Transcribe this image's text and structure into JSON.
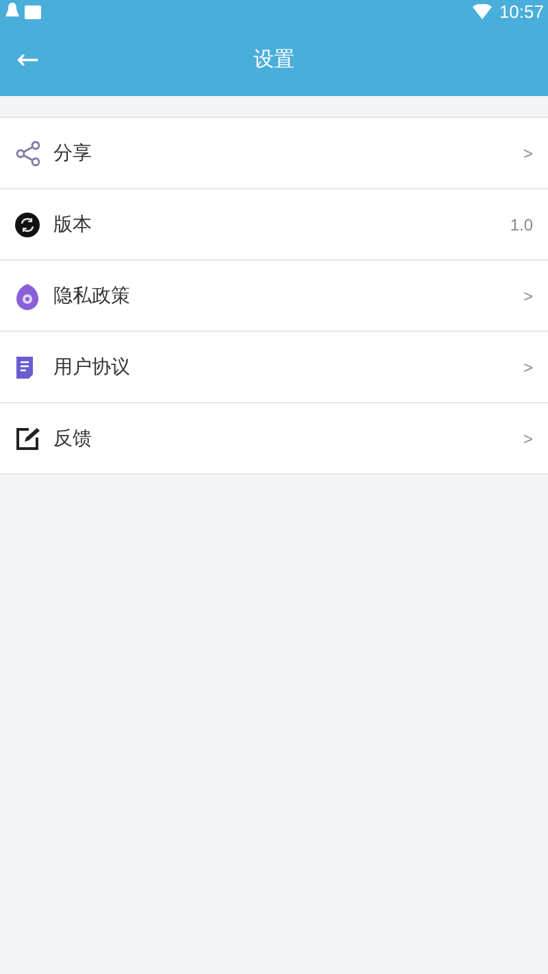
{
  "status_bar": {
    "time": "10:57"
  },
  "app_bar": {
    "back": "←",
    "title": "设置"
  },
  "items": [
    {
      "kind": "share",
      "label": "分享",
      "trailing": ">"
    },
    {
      "kind": "version",
      "label": "版本",
      "trailing": "1.0"
    },
    {
      "kind": "privacy",
      "label": "隐私政策",
      "trailing": ">"
    },
    {
      "kind": "agreement",
      "label": "用户协议",
      "trailing": ">"
    },
    {
      "kind": "feedback",
      "label": "反馈",
      "trailing": ">"
    }
  ]
}
